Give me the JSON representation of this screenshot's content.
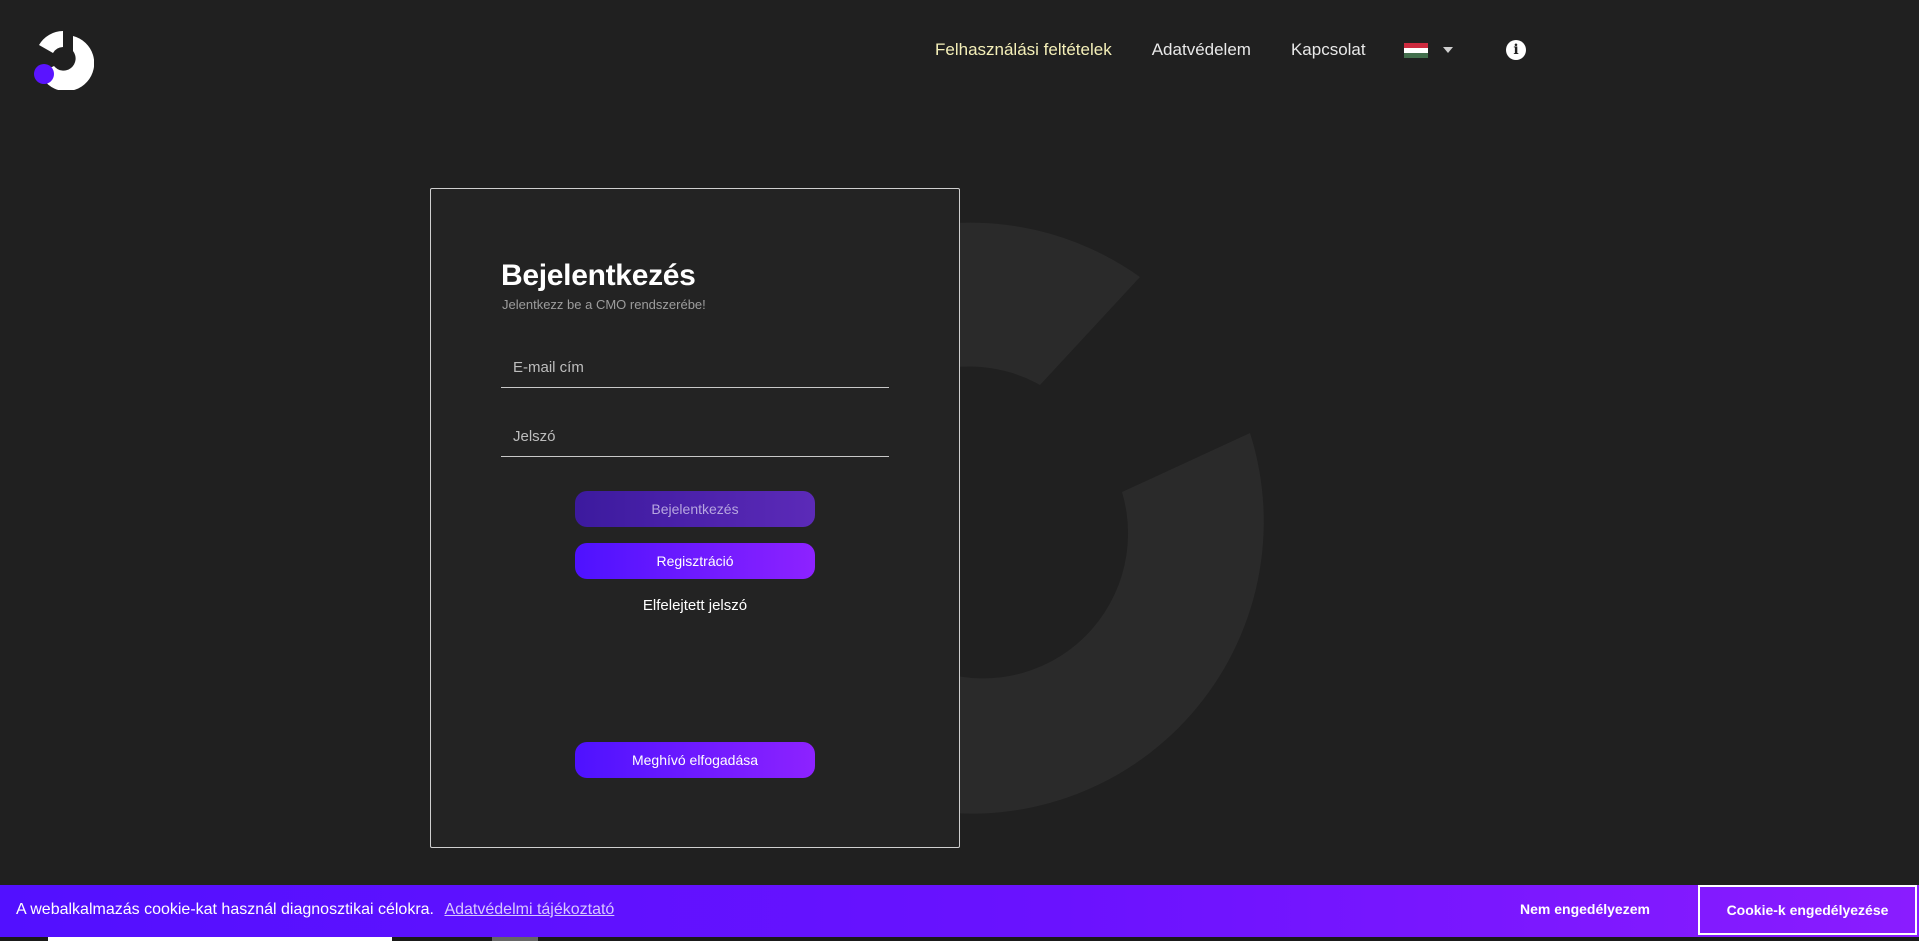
{
  "nav": {
    "terms": "Felhasználási feltételek",
    "privacy": "Adatvédelem",
    "contact": "Kapcsolat",
    "flag_colors": [
      "#cd2a3e",
      "#ffffff",
      "#436f4d"
    ],
    "info_label": "i"
  },
  "login": {
    "title": "Bejelentkezés",
    "subtitle": "Jelentkezz be a CMO rendszerébe!",
    "email_placeholder": "E-mail cím",
    "password_placeholder": "Jelszó",
    "login_button": "Bejelentkezés",
    "register_button": "Regisztráció",
    "forgot_password": "Elfelejtett jelszó",
    "accept_invite_button": "Meghívó elfogadása"
  },
  "cookie": {
    "message": "A webalkalmazás cookie-kat használ diagnosztikai célokra.",
    "policy_link": "Adatvédelmi tájékoztató",
    "deny_button": "Nem engedélyezem",
    "allow_button": "Cookie-k engedélyezése"
  },
  "colors": {
    "accent": "#5a14ff",
    "background": "#202020"
  }
}
